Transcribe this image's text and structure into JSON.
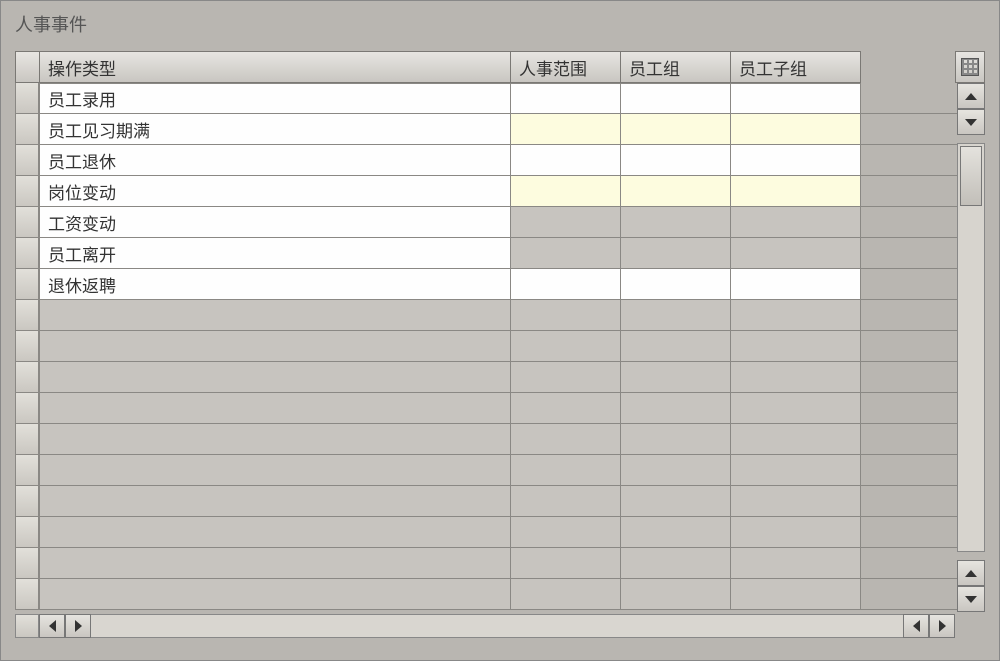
{
  "title": "人事事件",
  "columns": {
    "c1": "操作类型",
    "c2": "人事范围",
    "c3": "员工组",
    "c4": "员工子组"
  },
  "rows": [
    {
      "c1": "员工录用",
      "c2": "",
      "c3": "",
      "c4": "",
      "tone": "white"
    },
    {
      "c1": "员工见习期满",
      "c2": "",
      "c3": "",
      "c4": "",
      "tone": "light"
    },
    {
      "c1": "员工退休",
      "c2": "",
      "c3": "",
      "c4": "",
      "tone": "white"
    },
    {
      "c1": "岗位变动",
      "c2": "",
      "c3": "",
      "c4": "",
      "tone": "light"
    },
    {
      "c1": "工资变动",
      "c2": "",
      "c3": "",
      "c4": "",
      "tone": "grey"
    },
    {
      "c1": "员工离开",
      "c2": "",
      "c3": "",
      "c4": "",
      "tone": "grey"
    },
    {
      "c1": "退休返聘",
      "c2": "",
      "c3": "",
      "c4": "",
      "tone": "white"
    }
  ],
  "empty_rows": 10
}
